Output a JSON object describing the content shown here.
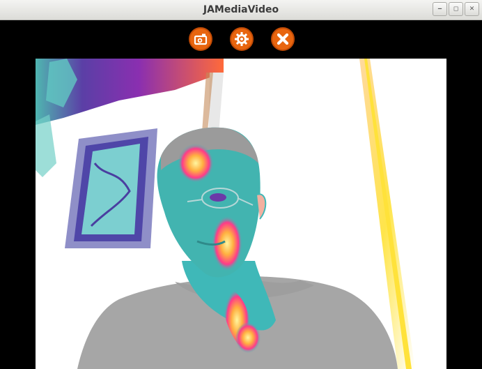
{
  "window": {
    "title": "JAMediaVideo"
  },
  "toolbar": {
    "buttons": [
      {
        "icon": "camera-icon"
      },
      {
        "icon": "gear-icon"
      },
      {
        "icon": "close-icon"
      }
    ],
    "accent": "#e8650f"
  },
  "titlebar_controls": {
    "minimize": "‒",
    "maximize": "◻",
    "close": "✕"
  }
}
